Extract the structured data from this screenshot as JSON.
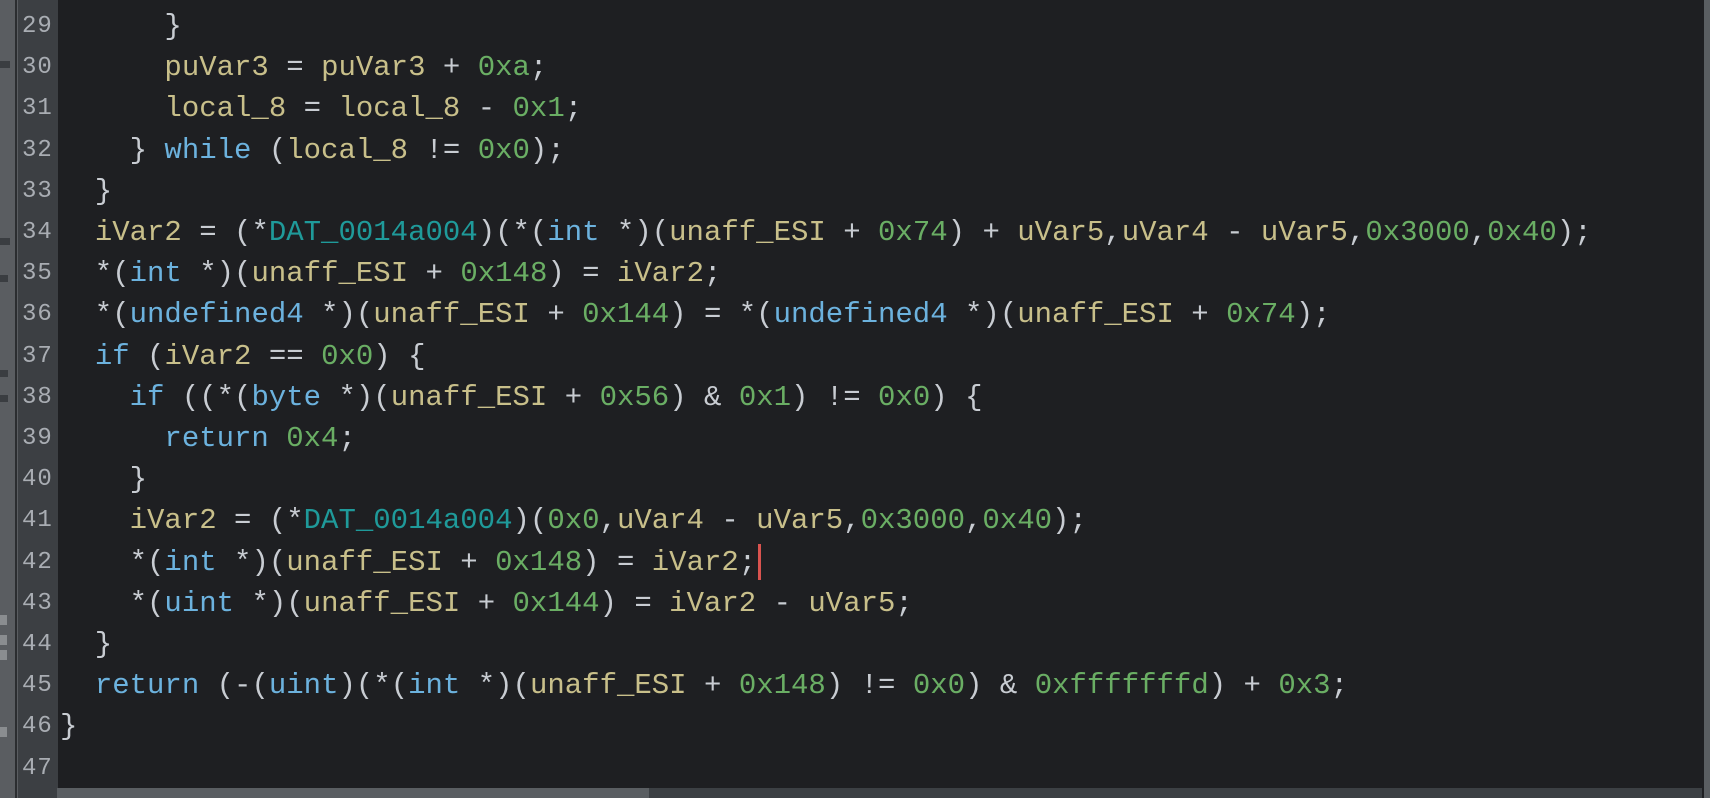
{
  "editor": {
    "view": "decompiler",
    "cursor_line": 42,
    "horizontal_scroll_fraction": 0.36,
    "lines": [
      {
        "number": "29",
        "tokens": [
          [
            "punct",
            "      }"
          ]
        ]
      },
      {
        "number": "30",
        "tokens": [
          [
            "punct",
            "      "
          ],
          [
            "var",
            "puVar3"
          ],
          [
            "punct",
            " = "
          ],
          [
            "var",
            "puVar3"
          ],
          [
            "punct",
            " + "
          ],
          [
            "num",
            "0xa"
          ],
          [
            "punct",
            ";"
          ]
        ]
      },
      {
        "number": "31",
        "tokens": [
          [
            "punct",
            "      "
          ],
          [
            "var",
            "local_8"
          ],
          [
            "punct",
            " = "
          ],
          [
            "var",
            "local_8"
          ],
          [
            "punct",
            " - "
          ],
          [
            "num",
            "0x1"
          ],
          [
            "punct",
            ";"
          ]
        ]
      },
      {
        "number": "32",
        "tokens": [
          [
            "punct",
            "    } "
          ],
          [
            "kw",
            "while"
          ],
          [
            "punct",
            " ("
          ],
          [
            "var",
            "local_8"
          ],
          [
            "punct",
            " != "
          ],
          [
            "num",
            "0x0"
          ],
          [
            "punct",
            ");"
          ]
        ]
      },
      {
        "number": "33",
        "tokens": [
          [
            "punct",
            "  }"
          ]
        ]
      },
      {
        "number": "34",
        "tokens": [
          [
            "punct",
            "  "
          ],
          [
            "var",
            "iVar2"
          ],
          [
            "punct",
            " = (*"
          ],
          [
            "glob",
            "DAT_0014a004"
          ],
          [
            "punct",
            ")(*("
          ],
          [
            "type",
            "int"
          ],
          [
            "punct",
            " *)("
          ],
          [
            "var",
            "unaff_ESI"
          ],
          [
            "punct",
            " + "
          ],
          [
            "num",
            "0x74"
          ],
          [
            "punct",
            ") + "
          ],
          [
            "var",
            "uVar5"
          ],
          [
            "punct",
            ","
          ],
          [
            "var",
            "uVar4"
          ],
          [
            "punct",
            " - "
          ],
          [
            "var",
            "uVar5"
          ],
          [
            "punct",
            ","
          ],
          [
            "num",
            "0x3000"
          ],
          [
            "punct",
            ","
          ],
          [
            "num",
            "0x40"
          ],
          [
            "punct",
            ");"
          ]
        ]
      },
      {
        "number": "35",
        "tokens": [
          [
            "punct",
            "  *("
          ],
          [
            "type",
            "int"
          ],
          [
            "punct",
            " *)("
          ],
          [
            "var",
            "unaff_ESI"
          ],
          [
            "punct",
            " + "
          ],
          [
            "num",
            "0x148"
          ],
          [
            "punct",
            ") = "
          ],
          [
            "var",
            "iVar2"
          ],
          [
            "punct",
            ";"
          ]
        ]
      },
      {
        "number": "36",
        "tokens": [
          [
            "punct",
            "  *("
          ],
          [
            "type",
            "undefined4"
          ],
          [
            "punct",
            " *)("
          ],
          [
            "var",
            "unaff_ESI"
          ],
          [
            "punct",
            " + "
          ],
          [
            "num",
            "0x144"
          ],
          [
            "punct",
            ") = *("
          ],
          [
            "type",
            "undefined4"
          ],
          [
            "punct",
            " *)("
          ],
          [
            "var",
            "unaff_ESI"
          ],
          [
            "punct",
            " + "
          ],
          [
            "num",
            "0x74"
          ],
          [
            "punct",
            ");"
          ]
        ]
      },
      {
        "number": "37",
        "tokens": [
          [
            "punct",
            "  "
          ],
          [
            "kw",
            "if"
          ],
          [
            "punct",
            " ("
          ],
          [
            "var",
            "iVar2"
          ],
          [
            "punct",
            " == "
          ],
          [
            "num",
            "0x0"
          ],
          [
            "punct",
            ") {"
          ]
        ]
      },
      {
        "number": "38",
        "tokens": [
          [
            "punct",
            "    "
          ],
          [
            "kw",
            "if"
          ],
          [
            "punct",
            " ((*("
          ],
          [
            "type",
            "byte"
          ],
          [
            "punct",
            " *)("
          ],
          [
            "var",
            "unaff_ESI"
          ],
          [
            "punct",
            " + "
          ],
          [
            "num",
            "0x56"
          ],
          [
            "punct",
            ") & "
          ],
          [
            "num",
            "0x1"
          ],
          [
            "punct",
            ") != "
          ],
          [
            "num",
            "0x0"
          ],
          [
            "punct",
            ") {"
          ]
        ]
      },
      {
        "number": "39",
        "tokens": [
          [
            "punct",
            "      "
          ],
          [
            "kw",
            "return"
          ],
          [
            "punct",
            " "
          ],
          [
            "num",
            "0x4"
          ],
          [
            "punct",
            ";"
          ]
        ]
      },
      {
        "number": "40",
        "tokens": [
          [
            "punct",
            "    }"
          ]
        ]
      },
      {
        "number": "41",
        "tokens": [
          [
            "punct",
            "    "
          ],
          [
            "var",
            "iVar2"
          ],
          [
            "punct",
            " = (*"
          ],
          [
            "glob",
            "DAT_0014a004"
          ],
          [
            "punct",
            ")("
          ],
          [
            "num",
            "0x0"
          ],
          [
            "punct",
            ","
          ],
          [
            "var",
            "uVar4"
          ],
          [
            "punct",
            " - "
          ],
          [
            "var",
            "uVar5"
          ],
          [
            "punct",
            ","
          ],
          [
            "num",
            "0x3000"
          ],
          [
            "punct",
            ","
          ],
          [
            "num",
            "0x40"
          ],
          [
            "punct",
            ");"
          ]
        ]
      },
      {
        "number": "42",
        "tokens": [
          [
            "punct",
            "    *("
          ],
          [
            "type",
            "int"
          ],
          [
            "punct",
            " *)("
          ],
          [
            "var",
            "unaff_ESI"
          ],
          [
            "punct",
            " + "
          ],
          [
            "num",
            "0x148"
          ],
          [
            "punct",
            ") = "
          ],
          [
            "var",
            "iVar2"
          ],
          [
            "punct",
            ";"
          ]
        ]
      },
      {
        "number": "43",
        "tokens": [
          [
            "punct",
            "    *("
          ],
          [
            "type",
            "uint"
          ],
          [
            "punct",
            " *)("
          ],
          [
            "var",
            "unaff_ESI"
          ],
          [
            "punct",
            " + "
          ],
          [
            "num",
            "0x144"
          ],
          [
            "punct",
            ") = "
          ],
          [
            "var",
            "iVar2"
          ],
          [
            "punct",
            " - "
          ],
          [
            "var",
            "uVar5"
          ],
          [
            "punct",
            ";"
          ]
        ]
      },
      {
        "number": "44",
        "tokens": [
          [
            "punct",
            "  }"
          ]
        ]
      },
      {
        "number": "45",
        "tokens": [
          [
            "punct",
            "  "
          ],
          [
            "kw",
            "return"
          ],
          [
            "punct",
            " (-("
          ],
          [
            "type",
            "uint"
          ],
          [
            "punct",
            ")(*("
          ],
          [
            "type",
            "int"
          ],
          [
            "punct",
            " *)("
          ],
          [
            "var",
            "unaff_ESI"
          ],
          [
            "punct",
            " + "
          ],
          [
            "num",
            "0x148"
          ],
          [
            "punct",
            ") != "
          ],
          [
            "num",
            "0x0"
          ],
          [
            "punct",
            ") & "
          ],
          [
            "num",
            "0xfffffffd"
          ],
          [
            "punct",
            ") + "
          ],
          [
            "num",
            "0x3"
          ],
          [
            "punct",
            ";"
          ]
        ]
      },
      {
        "number": "46",
        "tokens": [
          [
            "punct",
            "}"
          ]
        ]
      },
      {
        "number": "47",
        "tokens": []
      }
    ]
  },
  "colors": {
    "background": "#1e1f22",
    "gutter": "#3c3f43",
    "variable": "#c8bf8a",
    "keyword": "#6cb2de",
    "number": "#6aae64",
    "global": "#1f9a9a",
    "cursor": "#d9534f"
  }
}
